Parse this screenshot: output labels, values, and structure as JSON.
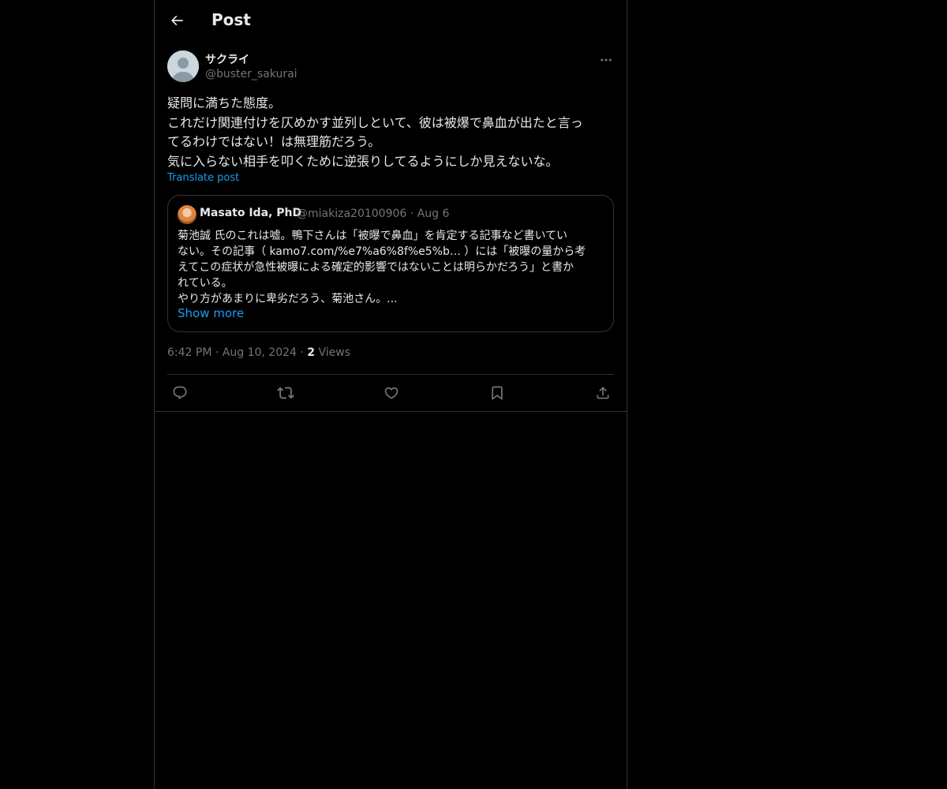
{
  "header": {
    "title": "Post"
  },
  "post": {
    "author_name": "サクライ",
    "author_handle": "@buster_sakurai",
    "text_lines": [
      "疑問に満ちた態度。",
      "これだけ関連付けを仄めかす並列しといて、彼は被爆で鼻血が出たと言っ",
      "てるわけではない！は無理筋だろう。",
      "気に入らない相手を叩くために逆張りしてるようにしか見えないな。"
    ],
    "translate_label": "Translate post",
    "time": "6:42 PM",
    "date": "Aug 10, 2024",
    "views_count": "2",
    "views_label": "Views",
    "meta_separator": "·"
  },
  "quote": {
    "author_name": "Masato Ida, PhD",
    "author_handle": "@miakiza20100906",
    "date": "Aug 6",
    "separator": "·",
    "text_lines": [
      "菊池誠 氏のこれは嘘。鴨下さんは「被曝で鼻血」を肯定する記事など書いてい",
      "ない。その記事（ kamo7.com/%e7%a6%8f%e5%b… ）には「被曝の量から考",
      "えてこの症状が急性被曝による確定的影響ではないことは明らかだろう」と書か",
      "れている。",
      "やり方があまりに卑劣だろう、菊池さん。..."
    ],
    "show_more_label": "Show more"
  },
  "icons": {
    "back": "arrow-left-icon",
    "more": "more-horizontal-icon",
    "reply": "reply-icon",
    "repost": "repost-icon",
    "like": "heart-icon",
    "bookmark": "bookmark-icon",
    "share": "share-icon"
  },
  "colors": {
    "background": "#000000",
    "text": "#e7e9ea",
    "muted": "#71767b",
    "accent": "#1d9bf0",
    "border": "#2f3336"
  }
}
